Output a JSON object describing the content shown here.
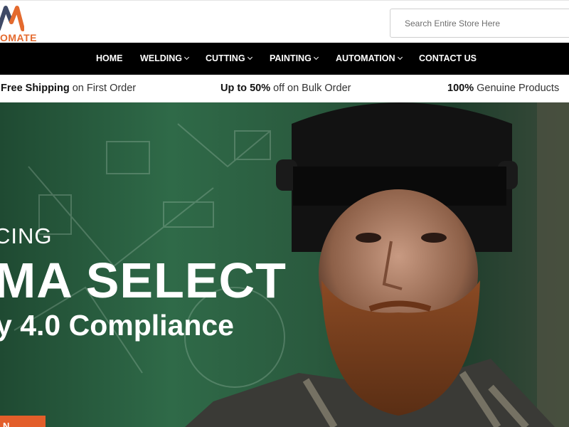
{
  "brand": {
    "logo_text": "OMATE",
    "accent_color": "#e46a2e",
    "mark_colors": [
      "#3f4a66",
      "#e46a2e"
    ]
  },
  "search": {
    "placeholder": "Search Entire Store Here",
    "value": ""
  },
  "nav": {
    "items": [
      {
        "label": "HOME",
        "has_dropdown": false
      },
      {
        "label": "WELDING",
        "has_dropdown": true
      },
      {
        "label": "CUTTING",
        "has_dropdown": true
      },
      {
        "label": "PAINTING",
        "has_dropdown": true
      },
      {
        "label": "AUTOMATION",
        "has_dropdown": true
      },
      {
        "label": "CONTACT US",
        "has_dropdown": false
      }
    ],
    "background": "#000000"
  },
  "promo": {
    "items": [
      {
        "bold": "Free Shipping",
        "text": " on First Order"
      },
      {
        "bold": "Up to 50%",
        "text": " off on Bulk Order"
      },
      {
        "bold": "100%",
        "text": " Genuine Products"
      }
    ]
  },
  "hero": {
    "line1": "CING",
    "line2": "MA SELECT",
    "line3": "y 4.0 Compliance",
    "cta_label": "N",
    "cta_color": "#e35e2a",
    "image": "welder-with-beard-and-welding-helmet-photo"
  }
}
